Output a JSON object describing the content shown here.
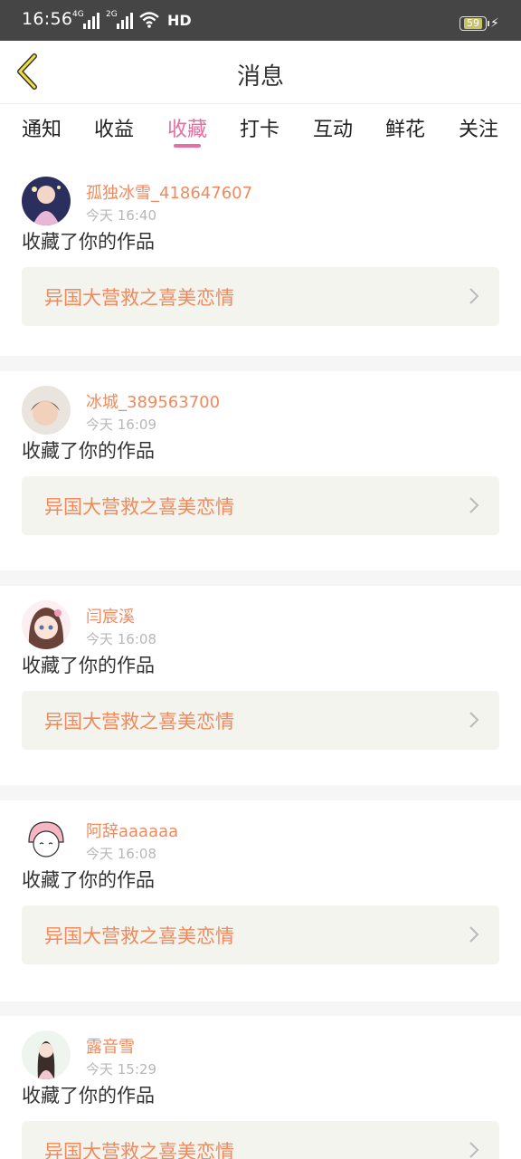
{
  "status_bar": {
    "time": "16:56",
    "signal1_label": "4G",
    "signal2_label": "2G",
    "hd_label": "HD",
    "battery": "59",
    "icons": [
      "signal-icon",
      "wifi-icon",
      "battery-icon",
      "charging-icon"
    ]
  },
  "header": {
    "back_icon": "chevron-left-icon",
    "title": "消息"
  },
  "tabs": [
    {
      "label": "通知"
    },
    {
      "label": "收益"
    },
    {
      "label": "收藏",
      "active": true
    },
    {
      "label": "打卡"
    },
    {
      "label": "互动"
    },
    {
      "label": "鲜花"
    },
    {
      "label": "关注"
    }
  ],
  "colors": {
    "accent_pink": "#e66ea0",
    "username_orange": "#f08a5d",
    "status_bar_bg": "#454545",
    "work_box_bg": "#f4f4ee"
  },
  "messages": [
    {
      "username": "孤独冰雪_418647607",
      "time": "今天 16:40",
      "action": "收藏了你的作品",
      "work": "异国大营救之喜美恋情"
    },
    {
      "username": "冰城_389563700",
      "time": "今天 16:09",
      "action": "收藏了你的作品",
      "work": "异国大营救之喜美恋情"
    },
    {
      "username": "闫宸溪",
      "time": "今天 16:08",
      "action": "收藏了你的作品",
      "work": "异国大营救之喜美恋情"
    },
    {
      "username": "阿辞aaaaaa",
      "time": "今天 16:08",
      "action": "收藏了你的作品",
      "work": "异国大营救之喜美恋情"
    },
    {
      "username": "露音雪",
      "time": "今天 15:29",
      "action": "收藏了你的作品",
      "work": "异国大营救之喜美恋情"
    }
  ]
}
